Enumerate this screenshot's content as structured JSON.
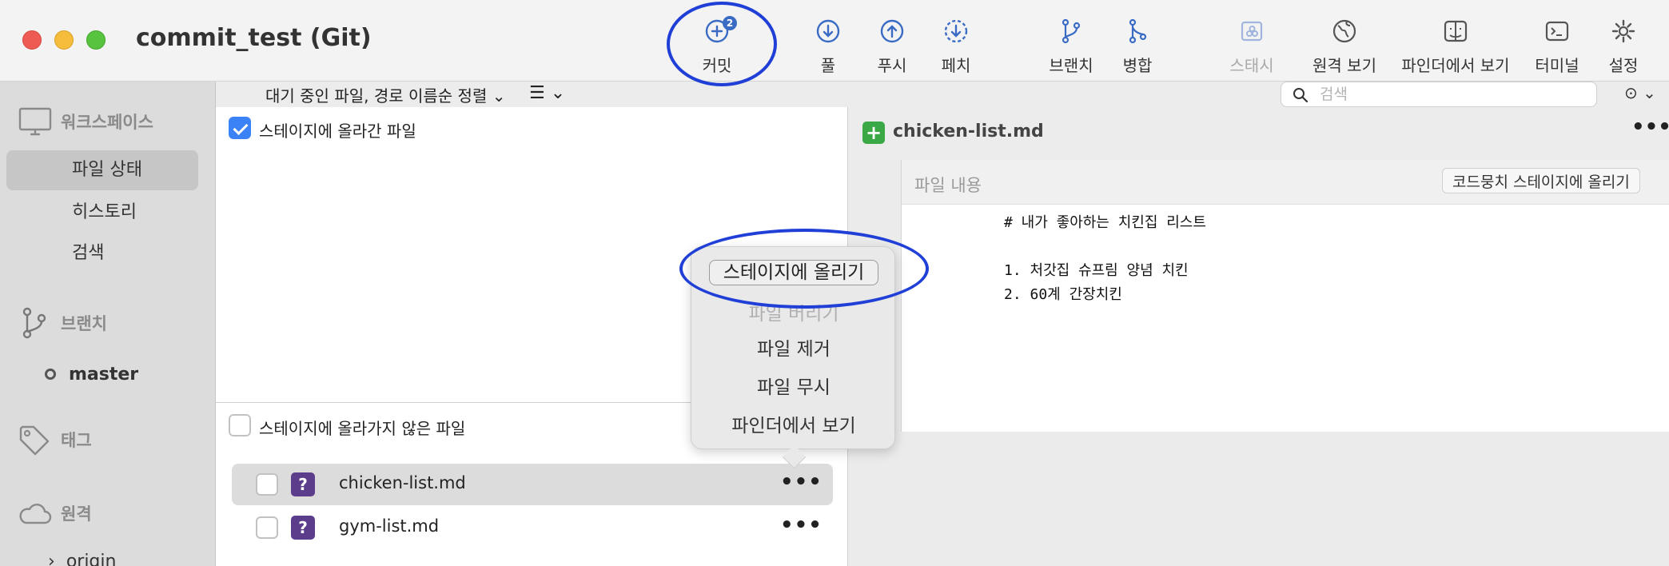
{
  "window": {
    "title": "commit_test (Git)"
  },
  "toolbar": {
    "commit": {
      "label": "커밋",
      "badge": "2"
    },
    "pull": "풀",
    "push": "푸시",
    "fetch": "페치",
    "branch": "브랜치",
    "merge": "병합",
    "stash": "스태시",
    "remote_view": "원격 보기",
    "show_in_finder": "파인더에서 보기",
    "terminal": "터미널",
    "settings": "설정"
  },
  "sidebar": {
    "workspace": {
      "title": "워크스페이스",
      "items": [
        "파일 상태",
        "히스토리",
        "검색"
      ],
      "selected": "파일 상태"
    },
    "branches": {
      "title": "브랜치",
      "current": "master"
    },
    "tags": {
      "title": "태그"
    },
    "remotes": {
      "title": "원격",
      "items": [
        "origin"
      ]
    }
  },
  "filter_bar": {
    "sort_label": "대기 중인 파일, 경로 이름순 정렬",
    "search_placeholder": "검색"
  },
  "staged": {
    "title": "스테이지에 올라간 파일",
    "checked": true,
    "files": []
  },
  "unstaged": {
    "title": "스테이지에 올라가지 않은 파일",
    "checked": false,
    "files": [
      {
        "name": "chicken-list.md",
        "status": "?",
        "selected": true
      },
      {
        "name": "gym-list.md",
        "status": "?",
        "selected": false
      }
    ]
  },
  "context_menu": {
    "primary": "스테이지에 올리기",
    "items": [
      {
        "label": "파일 버리기",
        "enabled": false
      },
      {
        "label": "파일 제거",
        "enabled": true
      },
      {
        "label": "파일 무시",
        "enabled": true
      },
      {
        "label": "파인더에서 보기",
        "enabled": true
      }
    ]
  },
  "diff": {
    "file_name": "chicken-list.md",
    "status": "+",
    "hunk_title": "파일 내용",
    "stage_hunk_label": "코드뭉치 스테이지에 올리기",
    "lines": [
      "# 내가 좋아하는 치킨집 리스트",
      "",
      "1. 처갓집 슈프림 양념 치킨",
      "2. 60계 간장치킨"
    ]
  },
  "colors": {
    "accent": "#3a82f6",
    "annotation": "#1f3fd6",
    "added": "#39a845",
    "untracked": "#5b3d8c"
  }
}
